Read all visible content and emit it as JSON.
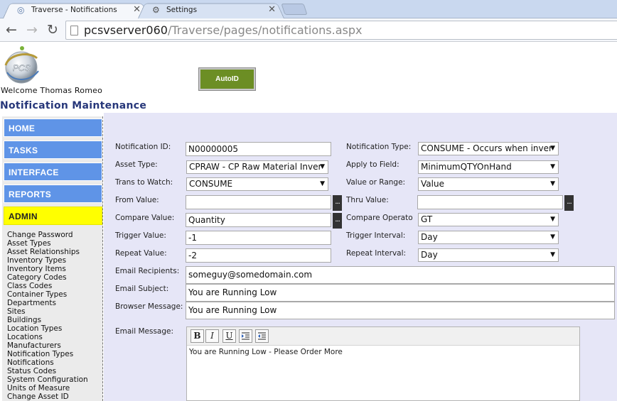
{
  "browser": {
    "tabs": [
      {
        "title": "Traverse - Notifications",
        "icon": "globe-icon"
      },
      {
        "title": "Settings",
        "icon": "gear-icon"
      }
    ],
    "url_host": "pcsvserver060",
    "url_path": "/Traverse/pages/notifications.aspx"
  },
  "header": {
    "logo_text": "PCS",
    "welcome": "Welcome Thomas Romeo",
    "autoid_label": "AutoID",
    "page_title": "Notification Maintenance"
  },
  "nav": {
    "tiles": [
      "HOME",
      "TASKS",
      "INTERFACE",
      "REPORTS",
      "ADMIN"
    ],
    "admin_items": [
      "Change Password",
      "Asset Types",
      "Asset Relationships",
      "Inventory Types",
      "Inventory Items",
      "Category Codes",
      "Class Codes",
      "Container Types",
      "Departments",
      "Sites",
      "Buildings",
      "Location Types",
      "Locations",
      "Manufacturers",
      "Notification Types",
      "Notifications",
      "Status Codes",
      "System Configuration",
      "Units of Measure",
      "Change Asset ID"
    ]
  },
  "form": {
    "notification_id_label": "Notification ID:",
    "notification_id_value": "N00000005",
    "asset_type_label": "Asset Type:",
    "asset_type_value": "CPRAW - CP Raw Material Inver",
    "trans_to_watch_label": "Trans to Watch:",
    "trans_to_watch_value": "CONSUME",
    "from_value_label": "From Value:",
    "from_value_value": "",
    "compare_value_label": "Compare Value:",
    "compare_value_value": "Quantity",
    "trigger_value_label": "Trigger Value:",
    "trigger_value_value": "-1",
    "repeat_value_label": "Repeat Value:",
    "repeat_value_value": "-2",
    "notification_type_label": "Notification Type:",
    "notification_type_value": "CONSUME - Occurs when inver",
    "apply_to_field_label": "Apply to Field:",
    "apply_to_field_value": "MinimumQTYOnHand",
    "value_or_range_label": "Value or Range:",
    "value_or_range_value": "Value",
    "thru_value_label": "Thru Value:",
    "thru_value_value": "",
    "compare_operator_label": "Compare Operato",
    "compare_operator_value": "GT",
    "trigger_interval_label": "Trigger Interval:",
    "trigger_interval_value": "Day",
    "repeat_interval_label": "Repeat Interval:",
    "repeat_interval_value": "Day",
    "email_recipients_label": "Email Recipients:",
    "email_recipients_value": "someguy@somedomain.com",
    "email_subject_label": "Email Subject:",
    "email_subject_value": "You are Running Low",
    "browser_message_label": "Browser Message:",
    "browser_message_value": "You are Running Low",
    "email_message_label": "Email Message:",
    "email_message_value": "You are Running Low - Please Order More",
    "lookup_button": "..."
  },
  "editor_toolbar": {
    "bold": "B",
    "italic": "I",
    "underline": "U"
  },
  "colors": {
    "nav_tile": "#5f94e7",
    "admin_tile": "#ffff00",
    "autoid": "#6c8e24",
    "panel": "#e6e6f7",
    "title": "#27377a"
  }
}
